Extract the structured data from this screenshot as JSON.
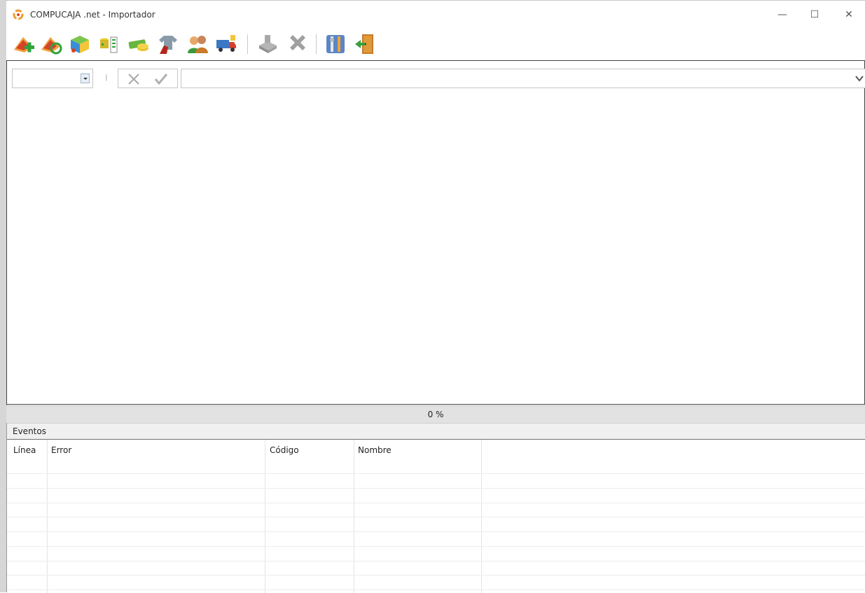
{
  "window": {
    "title": "COMPUCAJA .net - Importador",
    "controls": {
      "minimize": "—",
      "maximize": "☐",
      "close": "✕"
    }
  },
  "toolbar": {
    "buttons": [
      "import-add-icon",
      "import-refresh-icon",
      "product-cube-icon",
      "database-list-icon",
      "money-coins-icon",
      "clothing-icon",
      "customers-icon",
      "supplier-truck-icon",
      "printer-icon",
      "delete-x-icon",
      "settings-tools-icon",
      "exit-door-icon"
    ]
  },
  "filter": {
    "combo_value": "",
    "input_value": "",
    "separator": "⁞"
  },
  "progress": {
    "label": "0 %",
    "value": 0
  },
  "events": {
    "title": "Eventos",
    "columns": [
      "Línea",
      "Error",
      "Código",
      "Nombre"
    ],
    "rows": []
  },
  "colors": {
    "accent": "#f0a030",
    "border": "#444444",
    "progress_bg": "#e2e2e2"
  }
}
